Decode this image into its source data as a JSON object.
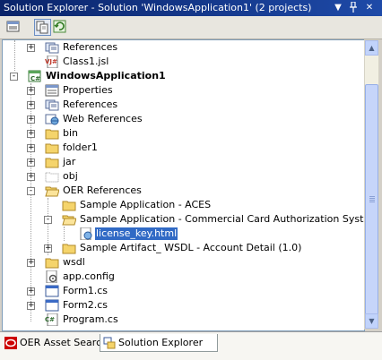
{
  "window": {
    "title": "Solution Explorer - Solution 'WindowsApplication1' (2 projects)",
    "buttons": [
      "dropdown",
      "pin",
      "close"
    ]
  },
  "toolbar": {
    "buttons": [
      {
        "name": "properties-button",
        "pressed": false
      },
      {
        "name": "show-all-files-button",
        "pressed": true
      },
      {
        "name": "refresh-button",
        "pressed": false
      }
    ]
  },
  "tree": {
    "items": [
      {
        "label": "References",
        "icon": "references-icon",
        "expander": "+",
        "indent": 1
      },
      {
        "label": "Class1.jsl",
        "icon": "jsl-file-icon",
        "expander": "",
        "indent": 1
      },
      {
        "label": "WindowsApplication1",
        "icon": "csharp-project-icon",
        "expander": "-",
        "indent": 0,
        "bold": true
      },
      {
        "label": "Properties",
        "icon": "properties-icon",
        "expander": "+",
        "indent": 1
      },
      {
        "label": "References",
        "icon": "references-icon",
        "expander": "+",
        "indent": 1
      },
      {
        "label": "Web References",
        "icon": "web-references-icon",
        "expander": "+",
        "indent": 1
      },
      {
        "label": "bin",
        "icon": "folder-icon",
        "expander": "+",
        "indent": 1
      },
      {
        "label": "folder1",
        "icon": "folder-icon",
        "expander": "+",
        "indent": 1
      },
      {
        "label": "jar",
        "icon": "folder-icon",
        "expander": "+",
        "indent": 1
      },
      {
        "label": "obj",
        "icon": "ghost-folder-icon",
        "expander": "+",
        "indent": 1
      },
      {
        "label": "OER References",
        "icon": "folder-open-icon",
        "expander": "-",
        "indent": 1
      },
      {
        "label": "Sample Application - ACES",
        "icon": "folder-icon",
        "expander": "",
        "indent": 2
      },
      {
        "label": "Sample Application - Commercial Card Authorization System",
        "icon": "folder-open-icon",
        "expander": "-",
        "indent": 2
      },
      {
        "label": "license_key.html",
        "icon": "html-file-icon",
        "expander": "",
        "indent": 3,
        "selected": true
      },
      {
        "label": "Sample Artifact_ WSDL - Account Detail (1.0)",
        "icon": "folder-icon",
        "expander": "+",
        "indent": 2
      },
      {
        "label": "wsdl",
        "icon": "folder-icon",
        "expander": "+",
        "indent": 1
      },
      {
        "label": "app.config",
        "icon": "config-file-icon",
        "expander": "",
        "indent": 1
      },
      {
        "label": "Form1.cs",
        "icon": "form-icon",
        "expander": "+",
        "indent": 1
      },
      {
        "label": "Form2.cs",
        "icon": "form-icon",
        "expander": "+",
        "indent": 1
      },
      {
        "label": "Program.cs",
        "icon": "cs-file-icon",
        "expander": "",
        "indent": 1
      }
    ]
  },
  "tabs": [
    {
      "label": "OER Asset Search",
      "icon": "oracle-icon",
      "active": false
    },
    {
      "label": "Solution Explorer",
      "icon": "solution-explorer-icon",
      "active": true
    }
  ],
  "colors": {
    "titlebar": "#0a246a",
    "selection": "#316ac5",
    "folder": "#f5d46b"
  }
}
